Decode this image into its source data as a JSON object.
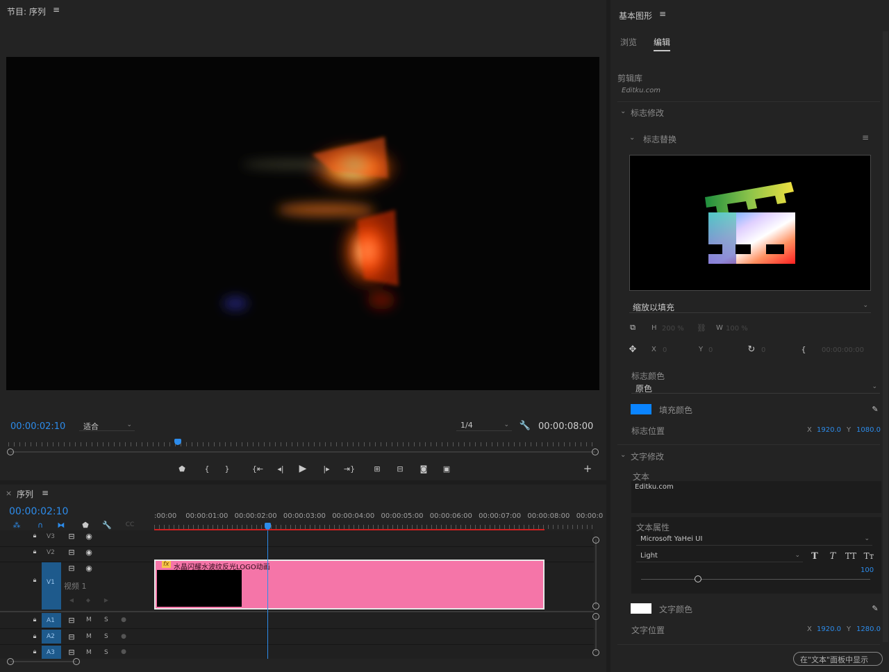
{
  "program_monitor": {
    "title": "节目: 序列",
    "menu_icon": "hamburger-icon",
    "timecode_current": "00:00:02:10",
    "zoom_select": "适合",
    "resolution_select": "1/4",
    "timecode_duration": "00:00:08:00"
  },
  "timeline": {
    "close_icon": "×",
    "title": "序列",
    "timecode": "00:00:02:10",
    "ruler_labels": [
      ":00:00",
      "00:00:01:00",
      "00:00:02:00",
      "00:00:03:00",
      "00:00:04:00",
      "00:00:05:00",
      "00:00:06:00",
      "00:00:07:00",
      "00:00:08:00",
      "00:00:0"
    ],
    "tracks": {
      "v3": "V3",
      "v2": "V2",
      "v1": "V1",
      "v1_name": "视频 1",
      "a1": "A1",
      "a2": "A2",
      "a3": "A3",
      "mute": "M",
      "solo": "S"
    },
    "clip": {
      "fx": "fx",
      "name": "水晶闪耀水波纹反光LOGO动画",
      "color": "#f575a8"
    },
    "playhead_fraction": 0.3
  },
  "essential_graphics": {
    "title": "基本图形",
    "tabs": [
      "浏览",
      "编辑"
    ],
    "active_tab": "编辑",
    "library_label": "剪辑库",
    "library_value": "Editku.com",
    "section_logo": "标志修改",
    "subsection_logo_replace": "标志替换",
    "scale_select": "缩放以填充",
    "h_label": "H",
    "h_value": "200 %",
    "w_label": "W",
    "w_value": "100 %",
    "x_label": "X",
    "x_value": "0",
    "y_label": "Y",
    "y_value": "0",
    "rotation_value": "0",
    "time_value": "00:00:00:00",
    "logo_color_label": "标志颜色",
    "logo_color_select": "原色",
    "fill_color_label": "填充颜色",
    "fill_color": "#0a84ff",
    "logo_pos_label": "标志位置",
    "logo_pos_x_label": "X",
    "logo_pos_x": "1920.0",
    "logo_pos_y_label": "Y",
    "logo_pos_y": "1080.0",
    "section_text": "文字修改",
    "text_label": "文本",
    "text_value": "Editku.com",
    "text_props_label": "文本属性",
    "font_family": "Microsoft YaHei UI",
    "font_style": "Light",
    "font_size": "100",
    "text_color_label": "文字颜色",
    "text_color": "#ffffff",
    "text_pos_label": "文字位置",
    "text_pos_x_label": "X",
    "text_pos_x": "1920.0",
    "text_pos_y_label": "Y",
    "text_pos_y": "1280.0",
    "show_in_text_panel": "在\"文本\"面板中显示"
  }
}
